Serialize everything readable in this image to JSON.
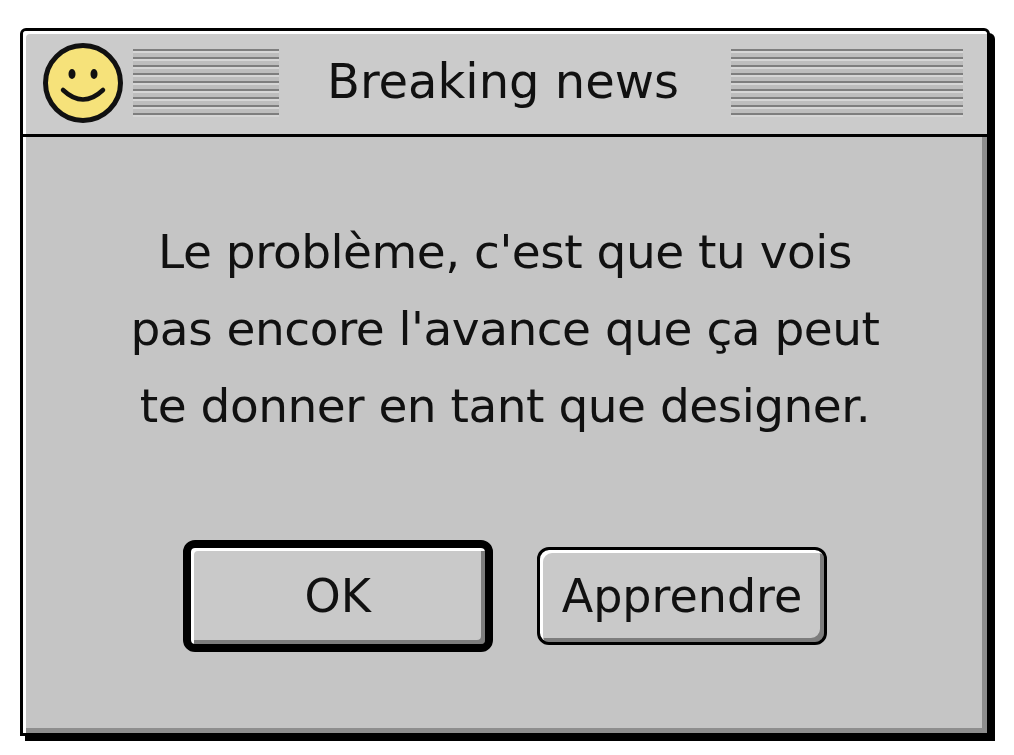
{
  "window": {
    "title": "Breaking news"
  },
  "message": "Le problème, c'est que tu vois pas encore l'avance que ça peut te donner en tant que designer.",
  "buttons": [
    {
      "label": "OK",
      "default": true
    },
    {
      "label": "Apprendre",
      "default": false
    }
  ]
}
